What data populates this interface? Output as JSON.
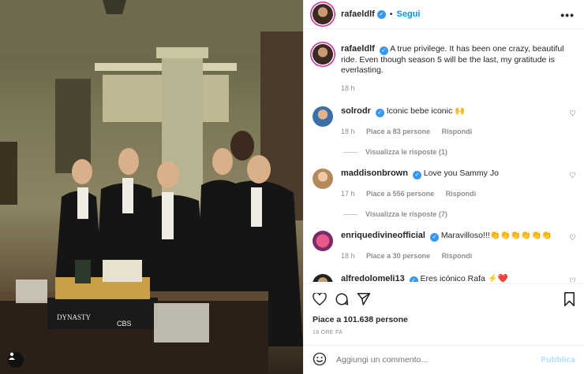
{
  "post": {
    "username": "rafaeldlf",
    "follow_label": "Segui",
    "more_label": "•••",
    "caption_text": "A true privilege. It has been one crazy, beautiful ride. Even though season 5 will be the last, my gratitude is everlasting.",
    "caption_time": "18 h",
    "likes_text": "Piace a 101.638 persone",
    "ago_text": "18 ORE FA"
  },
  "comments": [
    {
      "username": "solrodr",
      "text": "Iconic bebe iconic 🙌",
      "time": "18 h",
      "likes": "Piace a 83 persone",
      "reply_label": "Rispondi",
      "view_replies": "Visualizza le risposte (1)"
    },
    {
      "username": "maddisonbrown",
      "text": "Love you Sammy Jo",
      "time": "17 h",
      "likes": "Piace a 556 persone",
      "reply_label": "Rispondi",
      "view_replies": "Visualizza le risposte (7)"
    },
    {
      "username": "enriquedivineofficial",
      "text": "Maravilloso!!!👏👏👏👏👏👏",
      "time": "18 h",
      "likes": "Piace a 30 persone",
      "reply_label": "Rispondi"
    },
    {
      "username": "alfredolomeli13",
      "text": "Eres icónico Rafa ⚡❤️"
    }
  ],
  "add_comment": {
    "placeholder": "Aggiungi un commento...",
    "publish_label": "Pubblica"
  },
  "colors": {
    "accent": "#0095f6",
    "verified": "#3897f0",
    "publish_disabled": "#b2dffc"
  },
  "icons": [
    "heart-icon",
    "comment-icon",
    "share-icon",
    "save-icon",
    "emoji-icon",
    "tag-user-icon",
    "verified-badge-icon",
    "more-options-icon"
  ]
}
